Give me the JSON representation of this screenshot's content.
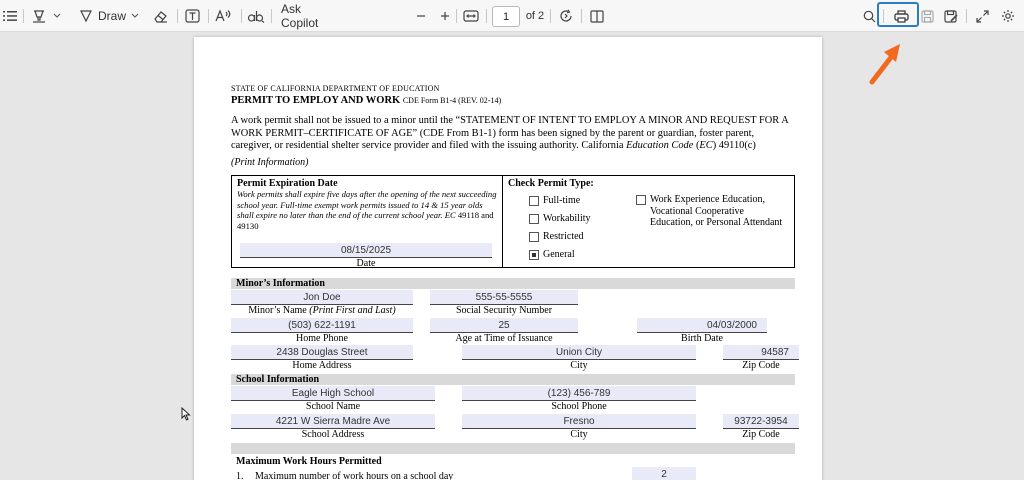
{
  "toolbar": {
    "draw_label": "Draw",
    "ask_copilot_label": "Ask Copilot",
    "page_number": "1",
    "page_of": "of 2"
  },
  "document": {
    "dept_header": "STATE OF CALIFORNIA DEPARTMENT OF EDUCATION",
    "title": "PERMIT TO EMPLOY AND WORK",
    "form_id": "CDE Form B1-4 (REV. 02-14)",
    "intro_part1": "A work permit shall not be issued to a minor until the “STATEMENT OF INTENT TO EMPLOY A MINOR AND REQUEST FOR A WORK PERMIT–CERTIFICATE OF AGE” (CDE From B1-1) form has been signed by the parent or guardian, foster parent, caregiver, or residential shelter service provider and filed with the issuing authority. California",
    "intro_italic": "Education Code",
    "intro_part2": "(",
    "intro_ec": "EC",
    "intro_part3": ") 49110(c)",
    "print_info": "(Print Information)",
    "expiration": {
      "title": "Permit Expiration Date",
      "text": "Work permits shall expire five days after the opening of the next succeeding school year. Full-time exempt work permits issued to 14 & 15 year olds shall expire no later than the end of the current school year.",
      "ec_ref": "EC",
      "ec_numbers": " 49118 and 49130",
      "date_value": "08/15/2025",
      "date_label": "Date"
    },
    "permit_type": {
      "title": "Check Permit Type:",
      "options": [
        {
          "label": "Full-time",
          "checked": false
        },
        {
          "label": "Workability",
          "checked": false
        },
        {
          "label": "Restricted",
          "checked": false
        },
        {
          "label": "General",
          "checked": true
        }
      ],
      "work_exp_line1": "Work Experience Education,",
      "work_exp_line2": "Vocational Cooperative",
      "work_exp_line3": "Education, or Personal Attendant",
      "work_exp_checked": false
    },
    "minor": {
      "section_title": "Minor’s Information",
      "name": "Jon Doe",
      "name_label": "Minor’s Name",
      "name_label_italic": "(Print First and Last)",
      "ssn": "555-55-5555",
      "ssn_label": "Social Security Number",
      "phone": "(503) 622-1191",
      "phone_label": "Home Phone",
      "age": "25",
      "age_label": "Age at Time of Issuance",
      "birth_date": "04/03/2000",
      "birth_date_label": "Birth Date",
      "address": "2438 Douglas Street",
      "address_label": "Home Address",
      "city": "Union City",
      "city_label": "City",
      "zip": "94587",
      "zip_label": "Zip Code"
    },
    "school": {
      "section_title": "School Information",
      "name": "Eagle High School",
      "name_label": "School Name",
      "phone": "(123) 456-789",
      "phone_label": "School Phone",
      "address": "4221 W Sierra Madre Ave",
      "address_label": "School Address",
      "city": "Fresno",
      "city_label": "City",
      "zip": "93722-3954",
      "zip_label": "Zip Code"
    },
    "hours": {
      "section_title": "Maximum Work Hours Permitted",
      "item1_num": "1.",
      "item1_text": "Maximum number of work hours on a school day",
      "item1_value": "2"
    }
  },
  "colors": {
    "field_fill": "#e8ebf7",
    "highlight_border": "#2b7dbb",
    "arrow": "#f26a21"
  }
}
